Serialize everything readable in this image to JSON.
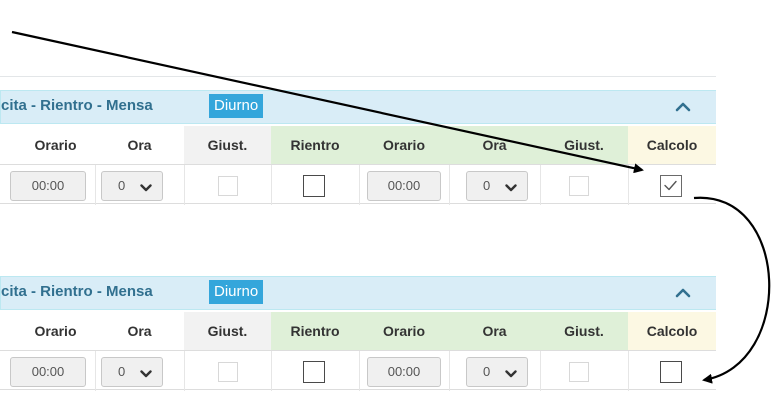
{
  "panels": [
    {
      "title": "cita - Rientro - Mensa",
      "badge": "Diurno",
      "columns": [
        "Orario",
        "Ora",
        "Giust.",
        "Rientro",
        "Orario",
        "Ora",
        "Giust.",
        "Calcolo"
      ],
      "row": {
        "orario_1": "00:00",
        "ora_1": "0",
        "giust_1_checked": false,
        "rientro_checked": false,
        "orario_2": "00:00",
        "ora_2": "0",
        "giust_2_checked": false,
        "calcolo_checked": true
      }
    },
    {
      "title": "cita - Rientro - Mensa",
      "badge": "Diurno",
      "columns": [
        "Orario",
        "Ora",
        "Giust.",
        "Rientro",
        "Orario",
        "Ora",
        "Giust.",
        "Calcolo"
      ],
      "row": {
        "orario_1": "00:00",
        "ora_1": "0",
        "giust_1_checked": false,
        "rientro_checked": false,
        "orario_2": "00:00",
        "ora_2": "0",
        "giust_2_checked": false,
        "calcolo_checked": false
      }
    }
  ],
  "icons": {
    "collapse": "chevron-up-icon",
    "select_caret": "chevron-down-icon",
    "check": "checkmark-icon"
  },
  "colors": {
    "panel_heading_bg": "#d9edf7",
    "panel_heading_text": "#31708f",
    "badge_bg": "#34a6db",
    "green_header_bg": "#dff0d8",
    "cream_header_bg": "#fcf8e3",
    "annotation_arrow": "#000000"
  }
}
